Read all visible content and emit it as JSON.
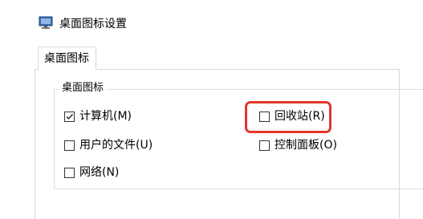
{
  "window": {
    "title": "桌面图标设置",
    "icon": "desktop-settings-icon"
  },
  "tabs": [
    {
      "label": "桌面图标",
      "selected": true
    }
  ],
  "group": {
    "label": "桌面图标"
  },
  "checkboxes": {
    "computer": {
      "label": "计算机(M)",
      "checked": true
    },
    "recycle_bin": {
      "label": "回收站(R)",
      "checked": false
    },
    "user_files": {
      "label": "用户的文件(U)",
      "checked": false
    },
    "control_panel": {
      "label": "控制面板(O)",
      "checked": false
    },
    "network": {
      "label": "网络(N)",
      "checked": false
    }
  },
  "colors": {
    "highlight": "#e0362c",
    "border": "#d9d9d9"
  }
}
